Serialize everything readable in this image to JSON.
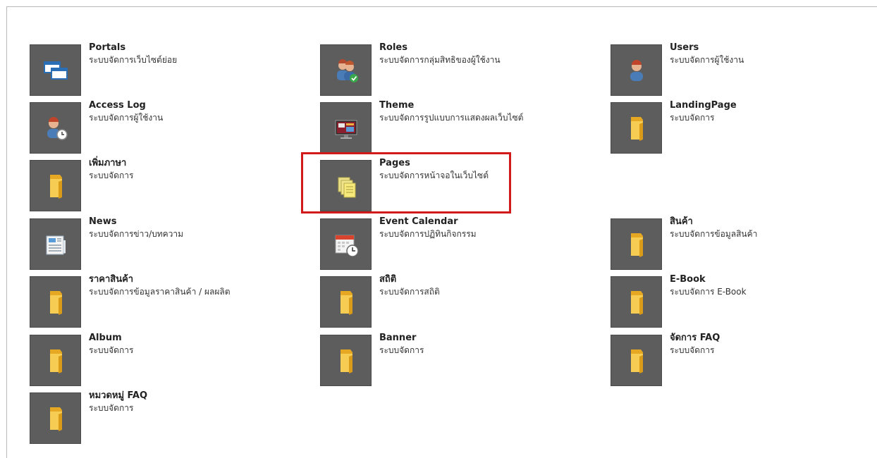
{
  "tiles": [
    {
      "title": "Portals",
      "desc": "ระบบจัดการเว็บไซต์ย่อย",
      "icon": "windows-icon"
    },
    {
      "title": "Roles",
      "desc": "ระบบจัดการกลุ่มสิทธิของผู้ใช้งาน",
      "icon": "user-group-check-icon"
    },
    {
      "title": "Users",
      "desc": "ระบบจัดการผู้ใช้งาน",
      "icon": "user-icon"
    },
    {
      "title": "Access Log",
      "desc": "ระบบจัดการผู้ใช้งาน",
      "icon": "user-clock-icon"
    },
    {
      "title": "Theme",
      "desc": "ระบบจัดการรูปแบบการแสดงผลเว็บไซต์",
      "icon": "monitor-icon"
    },
    {
      "title": "LandingPage",
      "desc": "ระบบจัดการ",
      "icon": "folder-icon"
    },
    {
      "title": "เพิ่มภาษา",
      "desc": "ระบบจัดการ",
      "icon": "folder-icon"
    },
    {
      "title": "Pages",
      "desc": "ระบบจัดการหน้าจอในเว็บไซต์",
      "icon": "pages-icon"
    },
    {
      "title": "News",
      "desc": "ระบบจัดการข่าว/บทความ",
      "icon": "newspaper-icon"
    },
    {
      "title": "Event Calendar",
      "desc": "ระบบจัดการปฏิทินกิจกรรม",
      "icon": "calendar-clock-icon"
    },
    {
      "title": "สินค้า",
      "desc": "ระบบจัดการข้อมูลสินค้า",
      "icon": "folder-icon"
    },
    {
      "title": "ราคาสินค้า",
      "desc": "ระบบจัดการข้อมูลราคาสินค้า / ผลผลิต",
      "icon": "folder-icon"
    },
    {
      "title": "สถิติ",
      "desc": "ระบบจัดการสถิติ",
      "icon": "folder-icon"
    },
    {
      "title": "E-Book",
      "desc": "ระบบจัดการ E-Book",
      "icon": "folder-icon"
    },
    {
      "title": "Album",
      "desc": "ระบบจัดการ",
      "icon": "folder-icon"
    },
    {
      "title": "Banner",
      "desc": "ระบบจัดการ",
      "icon": "folder-icon"
    },
    {
      "title": "จัดการ FAQ",
      "desc": "ระบบจัดการ",
      "icon": "folder-icon"
    },
    {
      "title": "หมวดหมู่ FAQ",
      "desc": "ระบบจัดการ",
      "icon": "folder-icon"
    }
  ],
  "highlight": {
    "tile": "Pages",
    "color": "#d31a1a"
  },
  "colors": {
    "tile_bg": "#5d5d5d",
    "folder": "#f2c53d"
  }
}
